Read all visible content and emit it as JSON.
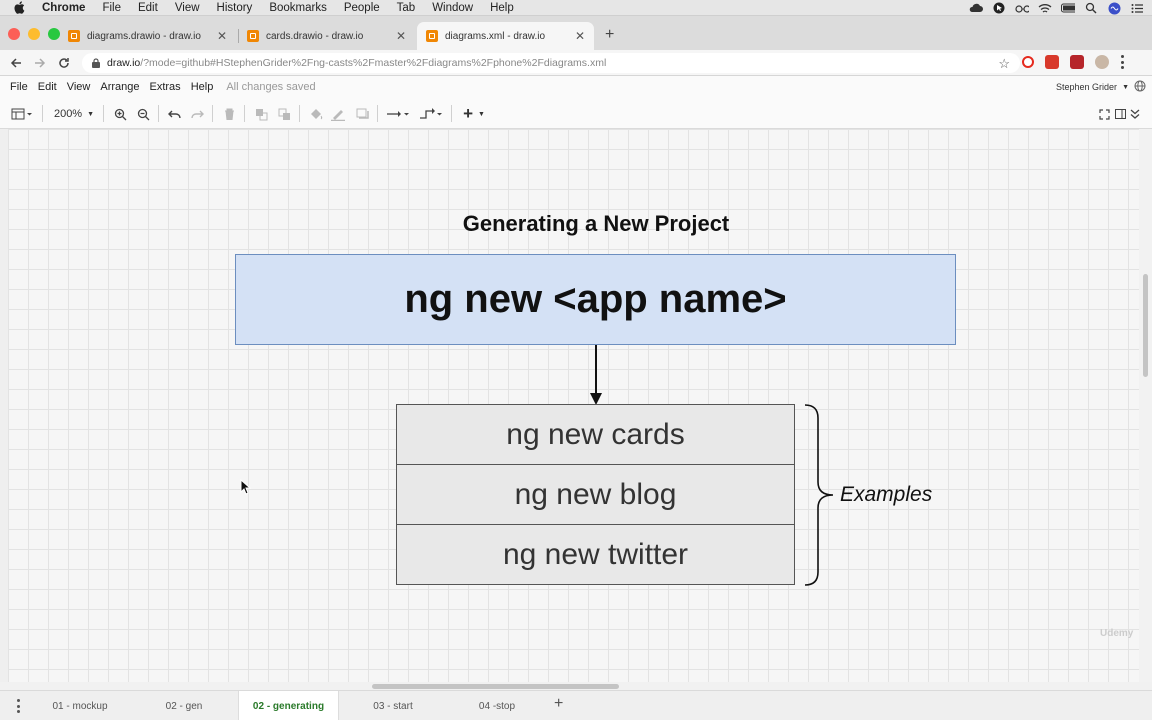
{
  "mac_menubar": {
    "app": "Chrome",
    "items": [
      "File",
      "Edit",
      "View",
      "History",
      "Bookmarks",
      "People",
      "Tab",
      "Window",
      "Help"
    ],
    "status_icons": [
      "cloud-icon",
      "cursor-icon",
      "glasses-icon",
      "wifi-icon",
      "battery-icon",
      "spotlight-icon",
      "siri-icon",
      "notification-list-icon"
    ]
  },
  "browser": {
    "tabs": [
      {
        "title": "diagrams.drawio - draw.io",
        "active": false
      },
      {
        "title": "cards.drawio - draw.io",
        "active": false
      },
      {
        "title": "diagrams.xml - draw.io",
        "active": true
      }
    ],
    "new_tab": "+",
    "url_host": "draw.io",
    "url_rest": "/?mode=github#HStephenGrider%2Fng-casts%2Fmaster%2Fdiagrams%2Fphone%2Fdiagrams.xml"
  },
  "app_menu": {
    "items": [
      "File",
      "Edit",
      "View",
      "Arrange",
      "Extras",
      "Help"
    ],
    "status": "All changes saved",
    "user": "Stephen Grider"
  },
  "toolbar": {
    "zoom": "200%",
    "plus": "+"
  },
  "diagram": {
    "title": "Generating a New Project",
    "command": "ng new <app name>",
    "examples": [
      "ng new cards",
      "ng new blog",
      "ng new twitter"
    ],
    "examples_label": "Examples",
    "watermark": "Udemy"
  },
  "pages": {
    "tabs": [
      {
        "label": "01 - mockup",
        "active": false
      },
      {
        "label": "02 - gen",
        "active": false
      },
      {
        "label": "02 - generating",
        "active": true
      },
      {
        "label": "03 - start",
        "active": false
      },
      {
        "label": "04 -stop",
        "active": false
      }
    ],
    "add": "+"
  },
  "colors": {
    "accent_box_fill": "#d4e1f5",
    "accent_box_stroke": "#6c8ebf",
    "active_page_tab": "#2a7a2a",
    "drawio_favicon": "#f08705"
  }
}
